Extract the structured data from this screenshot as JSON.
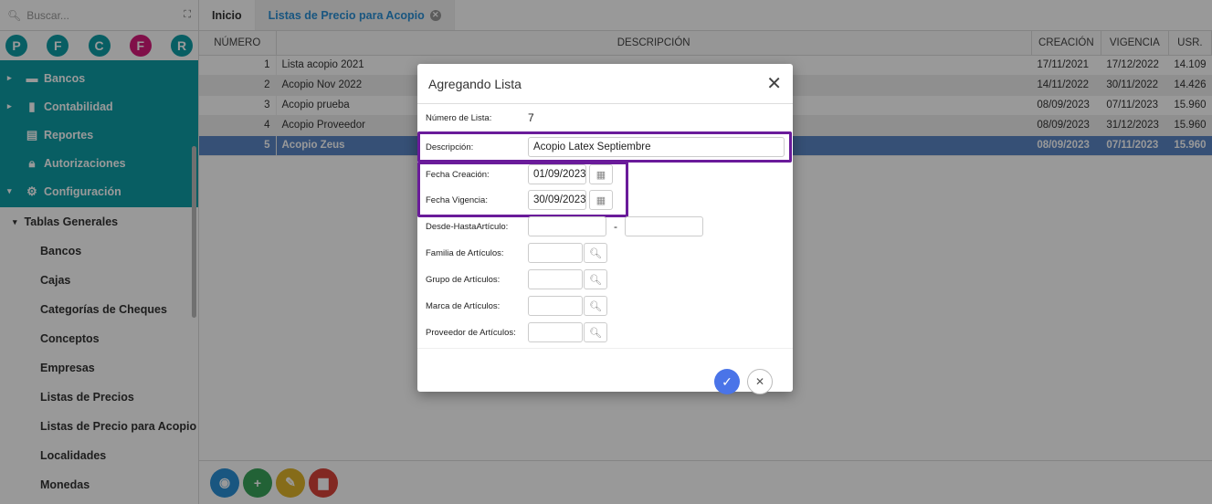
{
  "search": {
    "placeholder": "Buscar..."
  },
  "apps": [
    "P",
    "F",
    "C",
    "F",
    "R"
  ],
  "sidebar": {
    "modules": [
      {
        "label": "Bancos",
        "icon": "briefcase-icon",
        "caret": "▸"
      },
      {
        "label": "Contabilidad",
        "icon": "book-icon",
        "caret": "▸"
      },
      {
        "label": "Reportes",
        "icon": "report-icon",
        "caret": ""
      },
      {
        "label": "Autorizaciones",
        "icon": "lock-icon",
        "caret": ""
      },
      {
        "label": "Configuración",
        "icon": "gears-icon",
        "caret": "▾"
      }
    ],
    "group": "Tablas Generales",
    "items": [
      "Bancos",
      "Cajas",
      "Categorías de Cheques",
      "Conceptos",
      "Empresas",
      "Listas de Precios",
      "Listas de Precio para Acopio",
      "Localidades",
      "Monedas"
    ]
  },
  "tabs": [
    {
      "label": "Inicio"
    },
    {
      "label": "Listas de Precio para Acopio"
    }
  ],
  "table": {
    "headers": [
      "NÚMERO",
      "DESCRIPCIÓN",
      "CREACIÓN",
      "VIGENCIA",
      "USR."
    ],
    "rows": [
      [
        "1",
        "Lista acopio 2021",
        "17/11/2021",
        "17/12/2022",
        "14.109"
      ],
      [
        "2",
        "Acopio Nov 2022",
        "14/11/2022",
        "30/11/2022",
        "14.426"
      ],
      [
        "3",
        "Acopio prueba",
        "08/09/2023",
        "07/11/2023",
        "15.960"
      ],
      [
        "4",
        "Acopio Proveedor",
        "08/09/2023",
        "31/12/2023",
        "15.960"
      ],
      [
        "5",
        "Acopio Zeus",
        "08/09/2023",
        "07/11/2023",
        "15.960"
      ]
    ]
  },
  "modal": {
    "title": "Agregando Lista",
    "numero_label": "Número de Lista:",
    "numero_value": "7",
    "descripcion_label": "Descripción:",
    "descripcion_value": "Acopio Latex Septiembre",
    "fecha_creacion_label": "Fecha Creación:",
    "fecha_creacion_value": "01/09/2023",
    "fecha_vigencia_label": "Fecha Vigencia:",
    "fecha_vigencia_value": "30/09/2023",
    "desde_hasta_label": "Desde-HastaArtículo:",
    "desde_hasta_sep": "-",
    "familia_label": "Familia de Artículos:",
    "grupo_label": "Grupo de Artículos:",
    "marca_label": "Marca de Artículos:",
    "proveedor_label": "Proveedor de Artículos:"
  },
  "colors": {
    "teal": "#0e9da6",
    "pink": "#d6197a",
    "highlight": "#6a1b9a",
    "selected_row": "#5b86c5",
    "confirm": "#4a74e8"
  },
  "footer_buttons": [
    {
      "name": "view-button",
      "icon": "eye-icon",
      "color": "#2a8fd6"
    },
    {
      "name": "add-button",
      "icon": "plus-icon",
      "color": "#3aa35a"
    },
    {
      "name": "edit-button",
      "icon": "pencil-icon",
      "color": "#e0b42a"
    },
    {
      "name": "delete-button",
      "icon": "trash-icon",
      "color": "#d9443a"
    }
  ]
}
